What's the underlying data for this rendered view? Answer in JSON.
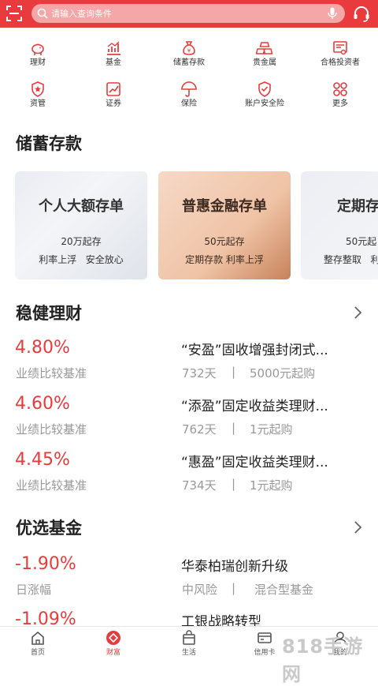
{
  "search": {
    "placeholder": "请输入查询条件"
  },
  "quick_menu": [
    {
      "label": "理财",
      "icon": "piggy-bank-icon"
    },
    {
      "label": "基金",
      "icon": "bar-chart-icon"
    },
    {
      "label": "储蓄存款",
      "icon": "money-bag-icon"
    },
    {
      "label": "贵金属",
      "icon": "gold-bars-icon"
    },
    {
      "label": "合格投资者",
      "icon": "certificate-icon"
    },
    {
      "label": "资管",
      "icon": "shield-star-icon"
    },
    {
      "label": "证券",
      "icon": "securities-chart-icon"
    },
    {
      "label": "保险",
      "icon": "umbrella-icon"
    },
    {
      "label": "账户安全险",
      "icon": "account-shield-icon"
    },
    {
      "label": "更多",
      "icon": "more-grid-icon"
    }
  ],
  "savings": {
    "title": "储蓄存款",
    "cards": [
      {
        "title": "个人大额存单",
        "line1": "20万起存",
        "line2": "利率上浮   安全放心"
      },
      {
        "title": "普惠金融存单",
        "line1": "50元起存",
        "line2": "定期存款 利率上浮"
      },
      {
        "title": "定期存",
        "line1": "50元起",
        "line2": "整存整取   利"
      }
    ]
  },
  "wealth": {
    "title": "稳健理财",
    "items": [
      {
        "rate": "4.80%",
        "rate_label": "业绩比较基准",
        "name": "“安盈”固收增强封闭式...",
        "term": "732天",
        "min": "5000元起购"
      },
      {
        "rate": "4.60%",
        "rate_label": "业绩比较基准",
        "name": "“添盈”固定收益类理财...",
        "term": "762天",
        "min": "1元起购"
      },
      {
        "rate": "4.45%",
        "rate_label": "业绩比较基准",
        "name": "“惠盈”固定收益类理财...",
        "term": "734天",
        "min": "1元起购"
      }
    ]
  },
  "funds": {
    "title": "优选基金",
    "items": [
      {
        "rate": "-1.90%",
        "rate_label": "日涨幅",
        "name": "华泰柏瑞创新升级",
        "risk": "中风险",
        "type": "混合型基金"
      },
      {
        "rate": "-1.09%",
        "rate_label": "",
        "name": "工银战略转型",
        "risk": "",
        "type": ""
      }
    ]
  },
  "separator": "|",
  "tabs": [
    {
      "label": "首页",
      "icon": "home-icon"
    },
    {
      "label": "财富",
      "icon": "wealth-diamond-icon"
    },
    {
      "label": "生活",
      "icon": "shopping-bag-icon"
    },
    {
      "label": "信用卡",
      "icon": "credit-card-icon"
    },
    {
      "label": "我的",
      "icon": "profile-icon"
    }
  ],
  "watermark": "818手游网",
  "colors": {
    "brand": "#e93b3d",
    "text": "#222222",
    "muted": "#999999"
  }
}
